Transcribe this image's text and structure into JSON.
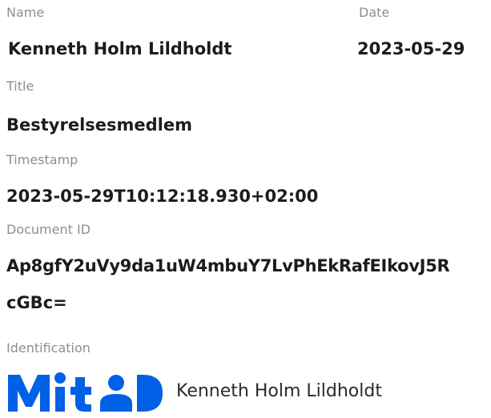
{
  "signer": {
    "name_label": "Name",
    "name_value": "Kenneth Holm Lildholdt",
    "date_label": "Date",
    "date_value": "2023-05-29",
    "title_label": "Title",
    "title_value": "Bestyrelsesmedlem",
    "timestamp_label": "Timestamp",
    "timestamp_value": "2023-05-29T10:12:18.930+02:00",
    "document_id_label": "Document ID",
    "document_id_line1": "Ap8gfY2uVy9da1uW4mbuY7LvPhEkRafEIkovJ5R",
    "document_id_line2": "cGBc=",
    "identification_label": "Identification"
  },
  "identification": {
    "logo_text": "MitID",
    "logo_color": "#0060e6",
    "name": "Kenneth Holm Lildholdt"
  }
}
